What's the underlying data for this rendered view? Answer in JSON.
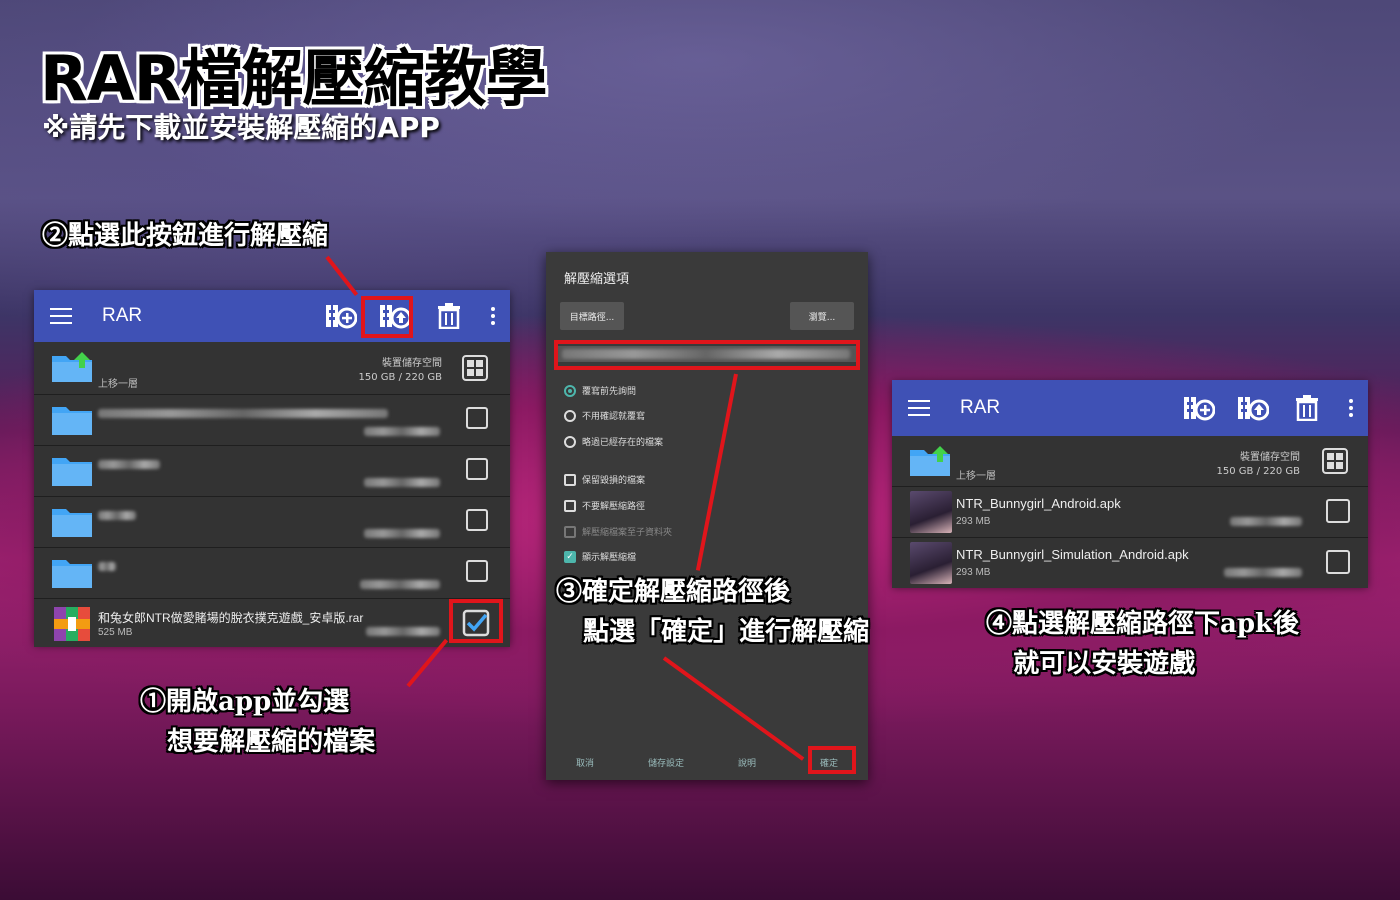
{
  "header": {
    "title": "RAR檔解壓縮教學",
    "subtitle": "※請先下載並安裝解壓縮的APP"
  },
  "annotations": {
    "step2": "②點選此按鈕進行解壓縮",
    "step1": "①開啟app並勾選\n   想要解壓縮的檔案",
    "step3": "③確定解壓縮路徑後\n   點選「確定」進行解壓縮",
    "step4": "④點選解壓縮路徑下apk後\n   就可以安裝遊戲"
  },
  "colors": {
    "accent": "#3f51b5",
    "highlight": "#e0151b",
    "teal": "#4db6ac"
  },
  "left_app": {
    "app_title": "RAR",
    "toolbar_icons": [
      "add-archive-icon",
      "extract-icon",
      "trash-icon",
      "more-vert-icon"
    ],
    "up_row": {
      "label": "上移一層",
      "storage_label": "裝置儲存空間",
      "storage_value": "150 GB / 220 GB"
    },
    "files": [
      {
        "name": "和兔女郎NTR做愛賭場的脫衣撲克遊戲_安卓版.rar",
        "size": "525 MB",
        "checked": true
      }
    ]
  },
  "dialog": {
    "title": "解壓縮選項",
    "target_button": "目標路徑...",
    "browse_button": "瀏覽...",
    "options": [
      {
        "label": "覆寫前先詢問",
        "type": "radio",
        "on": true
      },
      {
        "label": "不用確認就覆寫",
        "type": "radio",
        "on": false
      },
      {
        "label": "略過已經存在的檔案",
        "type": "radio",
        "on": false
      },
      {
        "label": "保留毀損的檔案",
        "type": "check",
        "on": false
      },
      {
        "label": "不要解壓縮路徑",
        "type": "check",
        "on": false
      },
      {
        "label": "解壓縮檔案至子資料夾",
        "type": "check",
        "on": false,
        "disabled": true
      },
      {
        "label": "顯示解壓縮檔",
        "type": "check",
        "on": true
      }
    ],
    "footer": {
      "cancel": "取消",
      "save_settings": "儲存設定",
      "help": "說明",
      "ok": "確定"
    }
  },
  "right_app": {
    "app_title": "RAR",
    "up_row": {
      "label": "上移一層",
      "storage_label": "裝置儲存空間",
      "storage_value": "150 GB / 220 GB"
    },
    "files": [
      {
        "name": "NTR_Bunnygirl_Android.apk",
        "size": "293 MB"
      },
      {
        "name": "NTR_Bunnygirl_Simulation_Android.apk",
        "size": "293 MB"
      }
    ]
  }
}
